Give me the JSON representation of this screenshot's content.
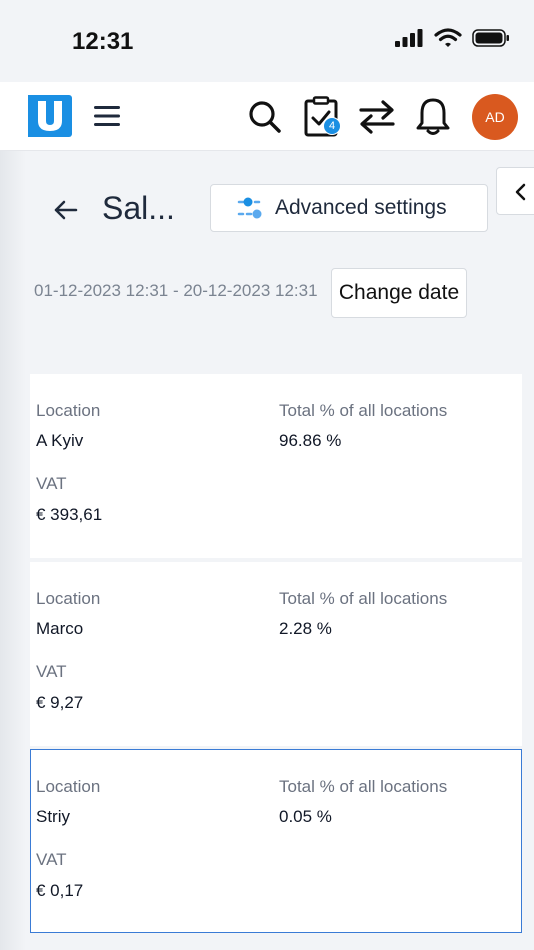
{
  "status_bar": {
    "time": "12:31"
  },
  "header": {
    "icons": [
      "logo-icon",
      "hamburger-icon",
      "search-icon",
      "tasks-icon",
      "transfer-icon",
      "bell-icon"
    ],
    "tasks_badge": "4",
    "avatar_initials": "AD",
    "avatar_color": "#d9591f",
    "accent_color": "#1a8fe3"
  },
  "page": {
    "title": "Sal...",
    "advanced_settings_label": "Advanced settings",
    "date_range": "01-12-2023 12:31 - 20-12-2023 12:31",
    "change_date_label": "Change date"
  },
  "cards": [
    {
      "location_label": "Location",
      "location": "A Kyiv",
      "percent_label": "Total % of all locations",
      "percent": "96.86 %",
      "vat_label": "VAT",
      "vat": "€ 393,61"
    },
    {
      "location_label": "Location",
      "location": "Marco",
      "percent_label": "Total % of all locations",
      "percent": "2.28 %",
      "vat_label": "VAT",
      "vat": "€ 9,27"
    },
    {
      "location_label": "Location",
      "location": "Striy",
      "percent_label": "Total % of all locations",
      "percent": "0.05 %",
      "vat_label": "VAT",
      "vat": "€ 0,17"
    }
  ]
}
